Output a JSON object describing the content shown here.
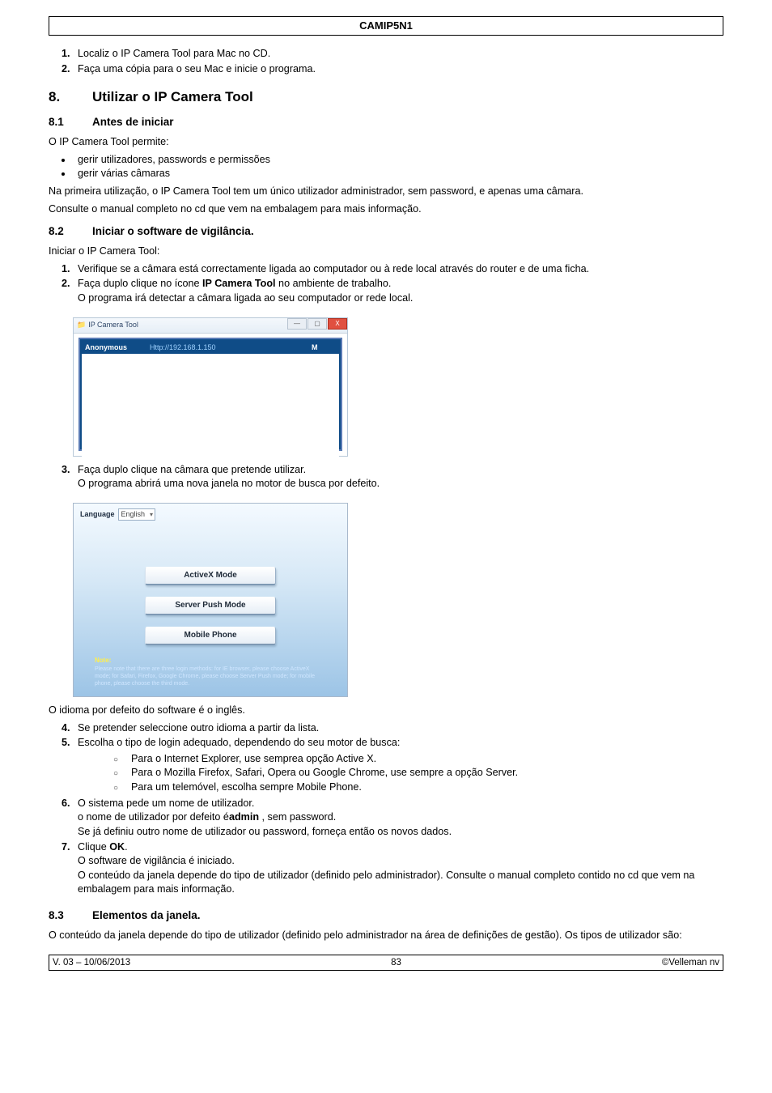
{
  "header": {
    "title": "CAMIP5N1"
  },
  "intro_list": [
    "Localiz o IP Camera Tool para Mac no CD.",
    "Faça uma cópia para o seu Mac e inicie o programa."
  ],
  "section8": {
    "num": "8.",
    "title": "Utilizar o IP Camera Tool"
  },
  "s81": {
    "num": "8.1",
    "title": "Antes de iniciar",
    "p1": "O IP Camera Tool permite:",
    "bullets": [
      "gerir utilizadores, passwords e permissões",
      "gerir várias câmaras"
    ],
    "p2": "Na primeira utilização, o IP Camera Tool tem um único utilizador administrador, sem password, e apenas uma câmara.",
    "p3": "Consulte o manual completo no cd que vem na embalagem para mais informação."
  },
  "s82": {
    "num": "8.2",
    "title": "Iniciar o software de vigilância.",
    "p1": "Iniciar o IP Camera Tool:",
    "step1": "Verifique se a câmara está correctamente ligada ao computador ou à rede local através do router e de uma ficha.",
    "step2a": "Faça duplo clique no ícone ",
    "step2b": "IP Camera Tool",
    "step2c": "  no ambiente de trabalho.",
    "step2note": "O programa irá detectar a câmara ligada ao seu computador or rede local.",
    "shot1": {
      "wintitle": "IP Camera Tool",
      "c1": "Anonymous",
      "c2": "Http://192.168.1.150",
      "c3": "M"
    },
    "step3": "Faça duplo clique na câmara que pretende utilizar.",
    "step3note": "O programa abrirá uma nova janela no motor de busca por defeito.",
    "shot2": {
      "lang_label": "Language",
      "lang_value": "English",
      "btn1": "ActiveX Mode",
      "btn2": "Server Push Mode",
      "btn3": "Mobile Phone",
      "note_title": "Note:",
      "note_body": "Please note that there are three login methods: for IE browser, please choose ActiveX mode; for Safari, Firefox, Google Chrome, please choose Server Push mode; for mobile phone, please choose the third mode."
    },
    "after_shot2": "O idioma por defeito do software é o inglês.",
    "step4": "Se pretender seleccione outro idioma a partir da lista.",
    "step5": "Escolha o tipo de login adequado, dependendo do seu motor de busca:",
    "step5_subs": [
      "Para o Internet Explorer, use semprea opção Active X.",
      "Para o Mozilla Firefox, Safari, Opera ou Google Chrome, use sempre a opção Server.",
      "Para um telemóvel, escolha sempre Mobile Phone."
    ],
    "step6": "O sistema pede um nome de utilizador.",
    "step6_line2a": "o nome de utilizador por defeito é",
    "step6_bold": "admin",
    "step6_line2b": " , sem password.",
    "step6_line3": "Se já definiu outro nome de utilizador ou password, forneça então os novos dados.",
    "step7a": "Clique ",
    "step7b": "OK",
    "step7c": ".",
    "step7_line2": "O software de vigilância é iniciado.",
    "step7_line3": "O conteúdo da janela depende do tipo de utilizador (definido pelo administrador). Consulte o manual completo contido no cd que vem na embalagem para mais informação."
  },
  "s83": {
    "num": "8.3",
    "title": "Elementos da janela.",
    "p1": "O conteúdo da janela depende do tipo de utilizador (definido pelo administrador na área de definições de gestão). Os tipos de utilizador são:"
  },
  "footer": {
    "left": "V. 03 – 10/06/2013",
    "center": "83",
    "right": "©Velleman nv"
  }
}
